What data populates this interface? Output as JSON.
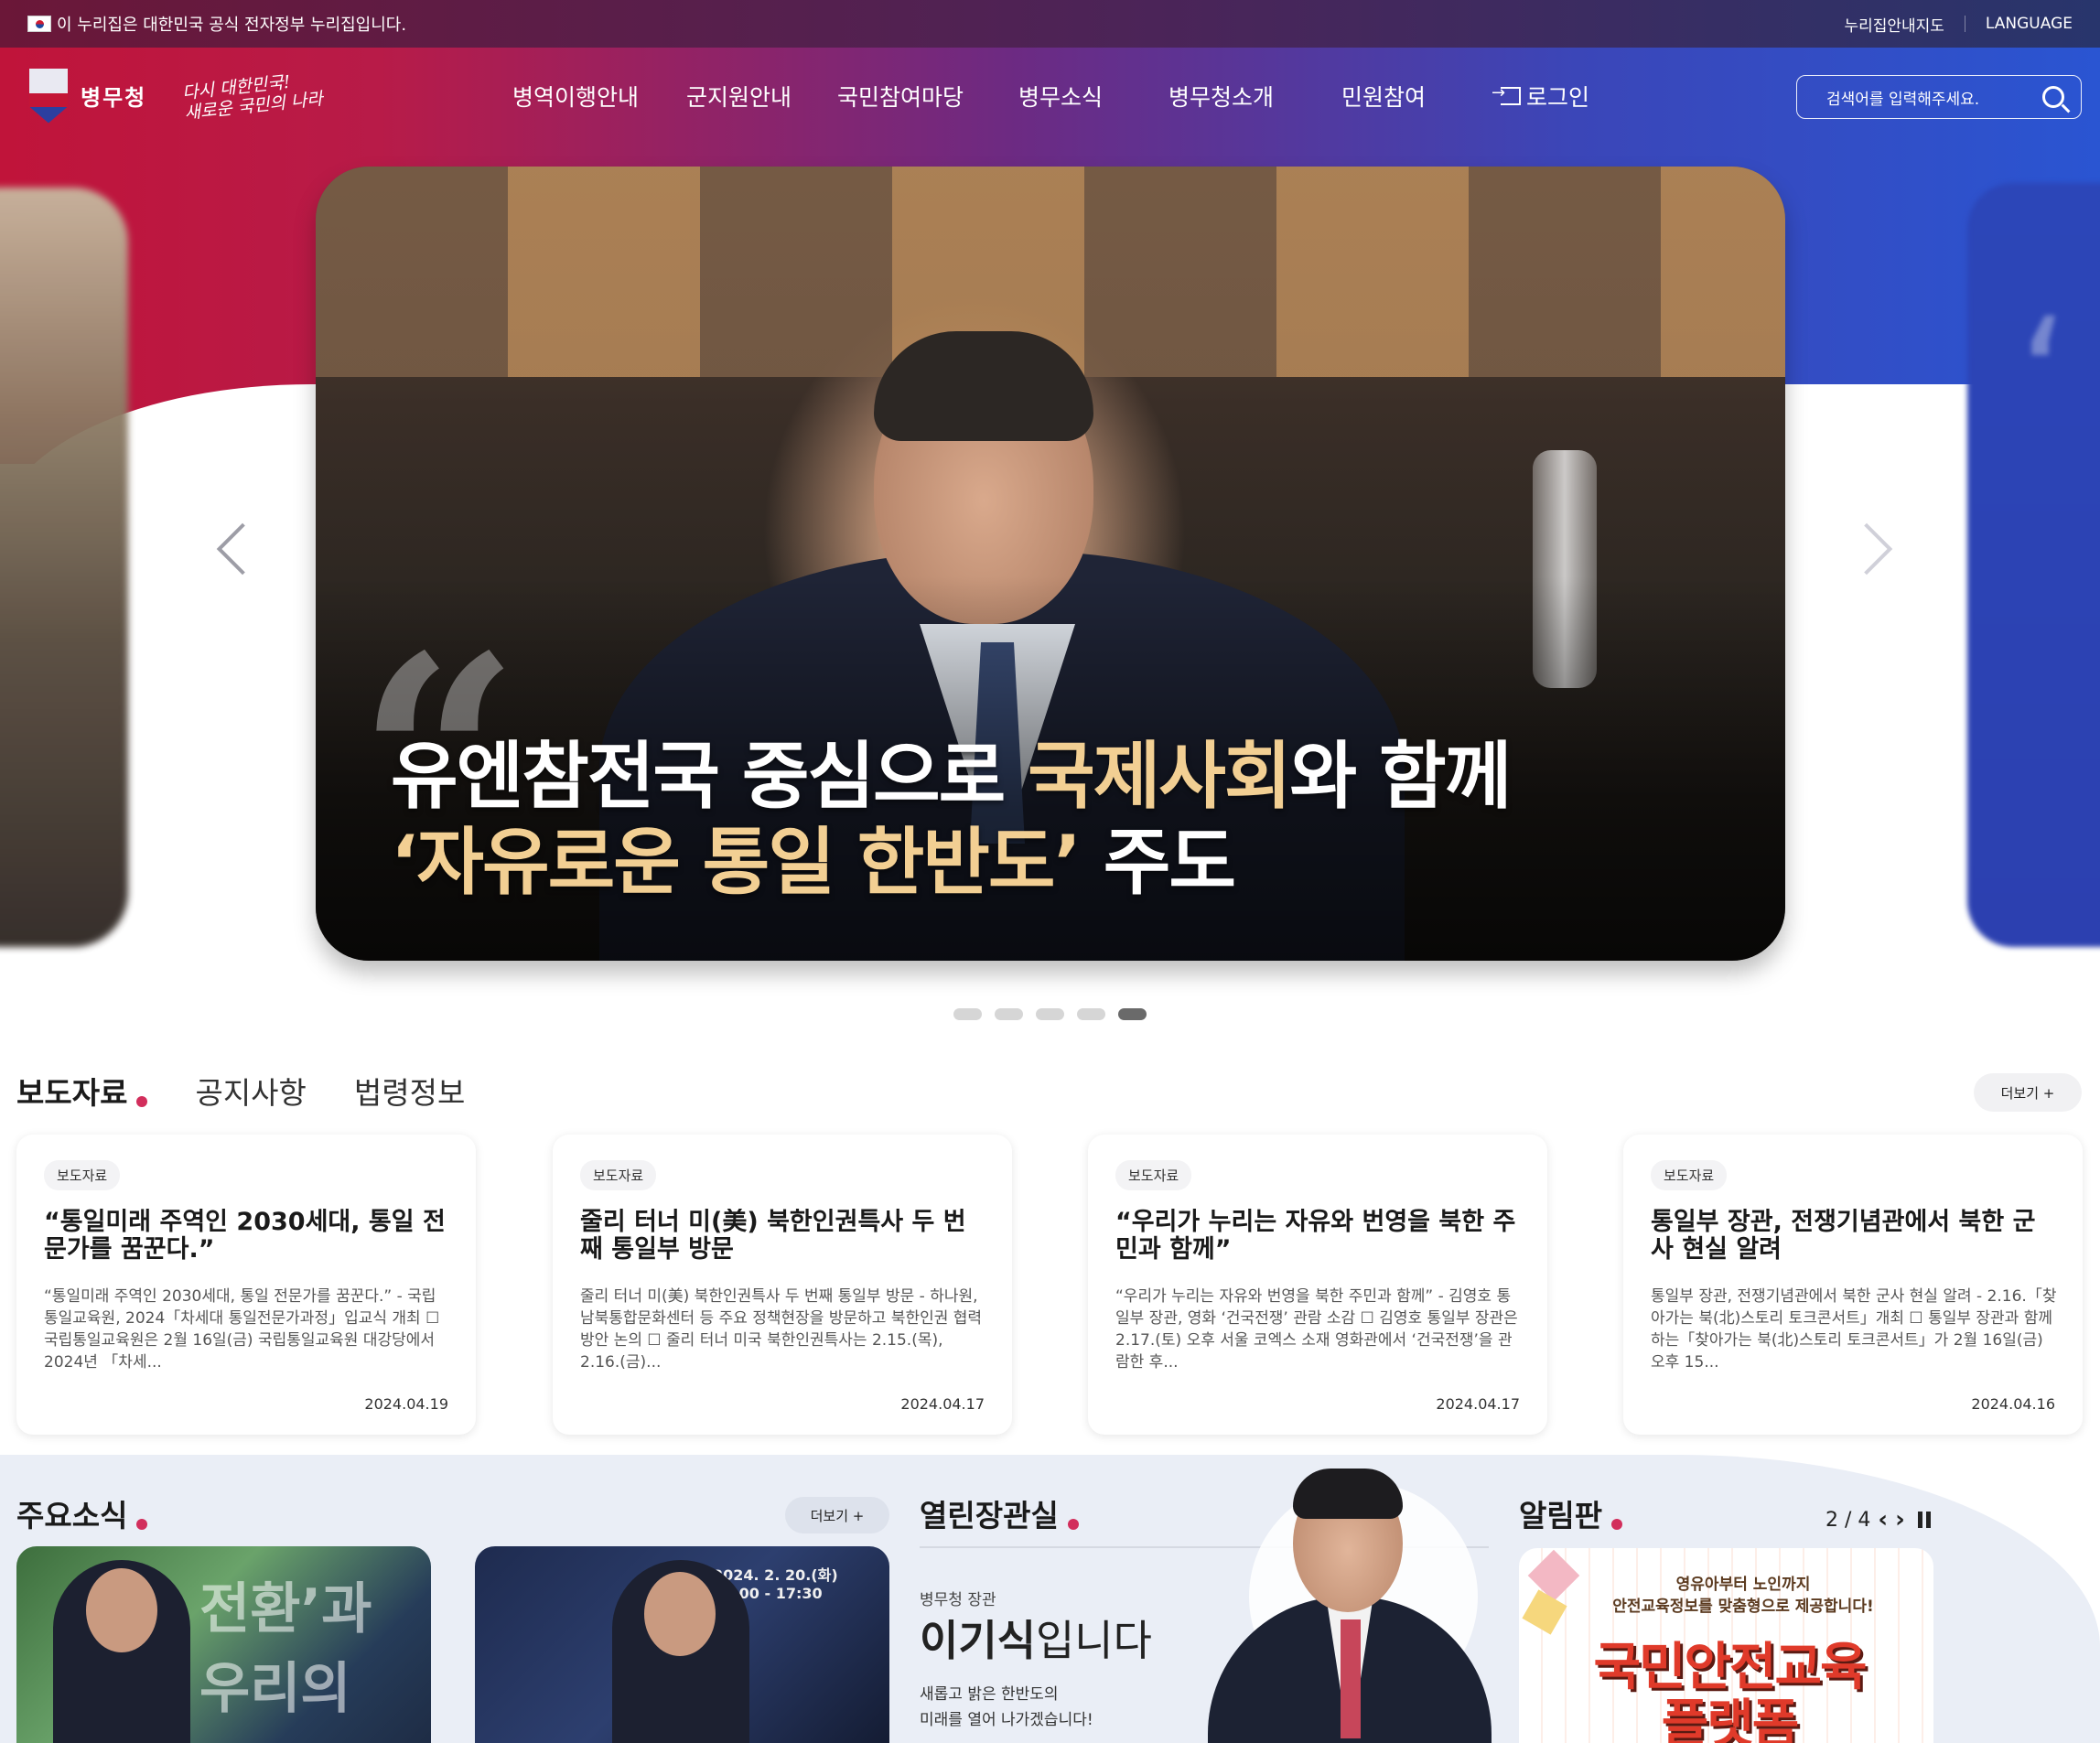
{
  "gov_banner": {
    "text": "이 누리집은 대한민국 공식 전자정부 누리집입니다.",
    "sitemap": "누리집안내지도",
    "language": "LANGUAGE"
  },
  "header": {
    "logo_text": "병무청",
    "slogan_line1": "다시 대한민국!",
    "slogan_line2": "새로운 국민의 나라",
    "nav": [
      "병역이행안내",
      "군지원안내",
      "국민참여마당",
      "병무소식",
      "병무청소개",
      "민원참여"
    ],
    "login": "로그인",
    "search_placeholder": "검색어를 입력해주세요."
  },
  "carousel": {
    "title_line1_pre": "유엔참전국 중심으로 ",
    "title_line1_hl": "국제사회",
    "title_line1_post": "와 함께",
    "title_line2_hl": "‘자유로운 통일 한반도’",
    "title_line2_post": " 주도",
    "slide_count": 5,
    "active_index": 4
  },
  "news": {
    "tabs": [
      "보도자료",
      "공지사항",
      "법령정보"
    ],
    "active_tab": "보도자료",
    "more": "더보기 +",
    "cards": [
      {
        "badge": "보도자료",
        "title": "“통일미래 주역인 2030세대, 통일 전문가를 꿈꾼다.”",
        "summary": "“통일미래 주역인 2030세대, 통일 전문가를 꿈꾼다.” - 국립통일교육원, 2024「차세대 통일전문가과정」입교식 개최 ☐ 국립통일교육원은 2월 16일(금) 국립통일교육원 대강당에서 2024년 「차세...",
        "date": "2024.04.19"
      },
      {
        "badge": "보도자료",
        "title": "줄리 터너 미(美) 북한인권특사 두 번째 통일부 방문",
        "summary": "줄리 터너 미(美) 북한인권특사 두 번째 통일부 방문 - 하나원, 남북통합문화센터 등 주요 정책현장을 방문하고 북한인권 협력방안 논의 ☐ 줄리 터너 미국 북한인권특사는 2.15.(목), 2.16.(금)...",
        "date": "2024.04.17"
      },
      {
        "badge": "보도자료",
        "title": "“우리가 누리는 자유와 번영을 북한 주민과 함께”",
        "summary": "“우리가 누리는 자유와 번영을 북한 주민과 함께” - 김영호 통일부 장관, 영화 ‘건국전쟁’ 관람 소감 ☐ 김영호 통일부 장관은 2.17.(토) 오후 서울 코엑스 소재 영화관에서 ‘건국전쟁’을 관람한 후...",
        "date": "2024.04.17"
      },
      {
        "badge": "보도자료",
        "title": "통일부 장관, 전쟁기념관에서 북한 군사 현실 알려",
        "summary": "통일부 장관, 전쟁기념관에서 북한 군사 현실 알려 - 2.16.「찾아가는 북(北)스토리 토크콘서트」개최 ☐ 통일부 장관과 함께하는「찾아가는 북(北)스토리 토크콘서트」가 2월 16일(금) 오후 15...",
        "date": "2024.04.16"
      }
    ]
  },
  "main_news": {
    "title": "주요소식",
    "more": "더보기 +",
    "img1_text": "전환’과 우리의",
    "img2_text": "2024. 2. 20.(화) 15:00 - 17:30"
  },
  "minister": {
    "title": "열린장관실",
    "role": "병무청 장관",
    "name_bold": "이기식",
    "name_rest": "입니다",
    "message_line1": "새롭고 밝은 한반도의",
    "message_line2": "미래를 열어 나가겠습니다!"
  },
  "notice_board": {
    "title": "알림판",
    "page": "2 / 4",
    "banner_sub_line1": "영유아부터 노인까지",
    "banner_sub_line2": "안전교육정보를 맞춤형으로 제공합니다!",
    "banner_big_line1": "국민안전교육",
    "banner_big_line2": "플랫폼"
  },
  "colors": {
    "accent_dot": "#d22e5c",
    "header_start": "#c0143a",
    "header_end": "#2a55d2",
    "highlight_text": "#f2cf93"
  }
}
